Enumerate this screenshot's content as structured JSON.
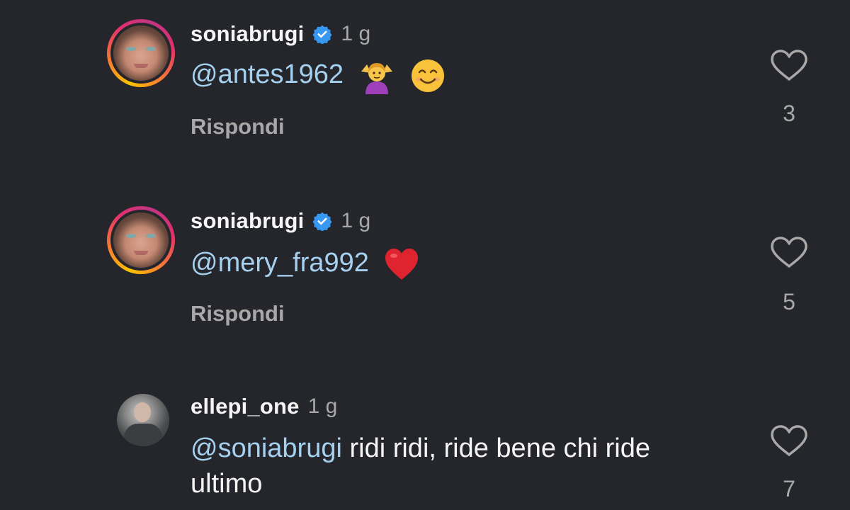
{
  "comments": [
    {
      "username": "soniabrugi",
      "verified": true,
      "time": "1 g",
      "mention": "@antes1962",
      "text": "",
      "emojis": [
        "woman-shrugging-emoji",
        "smiling-face-emoji"
      ],
      "reply_label": "Rispondi",
      "likes": "3",
      "avatar": "avatar-with-story-ring"
    },
    {
      "username": "soniabrugi",
      "verified": true,
      "time": "1 g",
      "mention": "@mery_fra992",
      "text": "",
      "emojis": [
        "red-heart-emoji"
      ],
      "reply_label": "Rispondi",
      "likes": "5",
      "avatar": "avatar-with-story-ring"
    },
    {
      "username": "ellepi_one",
      "verified": false,
      "time": "1 g",
      "mention": "@soniabrugi",
      "text": " ridi ridi, ride bene chi ride ultimo",
      "emojis": [],
      "likes": "7",
      "avatar": "avatar-plain"
    }
  ],
  "icons": {
    "like": "heart-outline-icon",
    "verified": "verified-badge-icon"
  },
  "colors": {
    "background": "#24262b",
    "mention": "#a6d0ef",
    "muted": "#a8a8a8",
    "verified": "#3897f0"
  }
}
